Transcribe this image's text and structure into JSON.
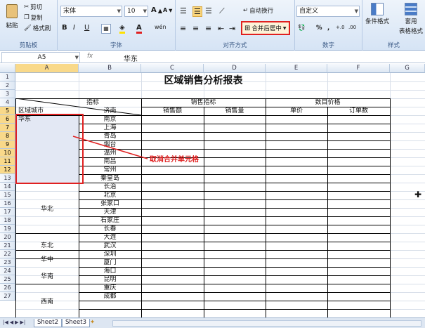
{
  "ribbon": {
    "clipboard": {
      "paste": "粘贴",
      "cut": "剪切",
      "copy": "复制",
      "format_painter": "格式刷",
      "label": "剪贴板"
    },
    "font": {
      "name": "宋体",
      "size": "10",
      "grow": "A",
      "shrink": "A",
      "bold": "B",
      "italic": "I",
      "underline": "U",
      "font_color": "A",
      "phonetic": "wén",
      "label": "字体"
    },
    "alignment": {
      "wrap": "自动换行",
      "merge": "合并后居中",
      "label": "对齐方式"
    },
    "number": {
      "format": "自定义",
      "percent": "%",
      "comma": ",",
      "inc": "+.0",
      "dec": ".00",
      "label": "数字"
    },
    "styles": {
      "conditional": "条件格式",
      "table": "套用",
      "table2": "表格格式",
      "label": "样式"
    },
    "highlight_color": "#e02020"
  },
  "formula_bar": {
    "name_box": "A5",
    "fx": "fx",
    "value": "华东"
  },
  "columns": [
    "A",
    "B",
    "C",
    "D",
    "E",
    "F",
    "G"
  ],
  "rows": [
    "1",
    "2",
    "3",
    "4",
    "5",
    "6",
    "7",
    "8",
    "9",
    "10",
    "11",
    "12",
    "13",
    "14",
    "15",
    "16",
    "17",
    "18",
    "19",
    "20",
    "21",
    "22",
    "23",
    "24",
    "25",
    "26",
    "27"
  ],
  "sheet": {
    "title": "区域销售分析报表",
    "header_indicator": "指标",
    "header_region": "区域城市",
    "sales_group": "销售指标",
    "price_group": "数目价格",
    "sales_amount": "销售额",
    "sales_qty": "销售量",
    "unit_price": "单价",
    "order_count": "订单数",
    "regions": [
      {
        "name": "华东",
        "cities": [
          "济南",
          "南京",
          "上海",
          "青岛",
          "烟台",
          "温州",
          "南昌",
          "常州"
        ]
      },
      {
        "name": "华北",
        "cities": [
          "秦皇岛",
          "长治",
          "北京",
          "张家口",
          "天津",
          "石家庄"
        ]
      },
      {
        "name": "东北",
        "cities": [
          "长春",
          "大连"
        ]
      },
      {
        "name": "华中",
        "cities": [
          "武汉"
        ]
      },
      {
        "name": "华南",
        "cities": [
          "深圳",
          "厦门",
          "海口"
        ]
      },
      {
        "name": "西南",
        "cities": [
          "昆明",
          "重庆",
          "成都"
        ]
      }
    ]
  },
  "annotation": "取消合并单元格",
  "tabs": {
    "sheet2": "Sheet2",
    "sheet3": "Sheet3"
  }
}
